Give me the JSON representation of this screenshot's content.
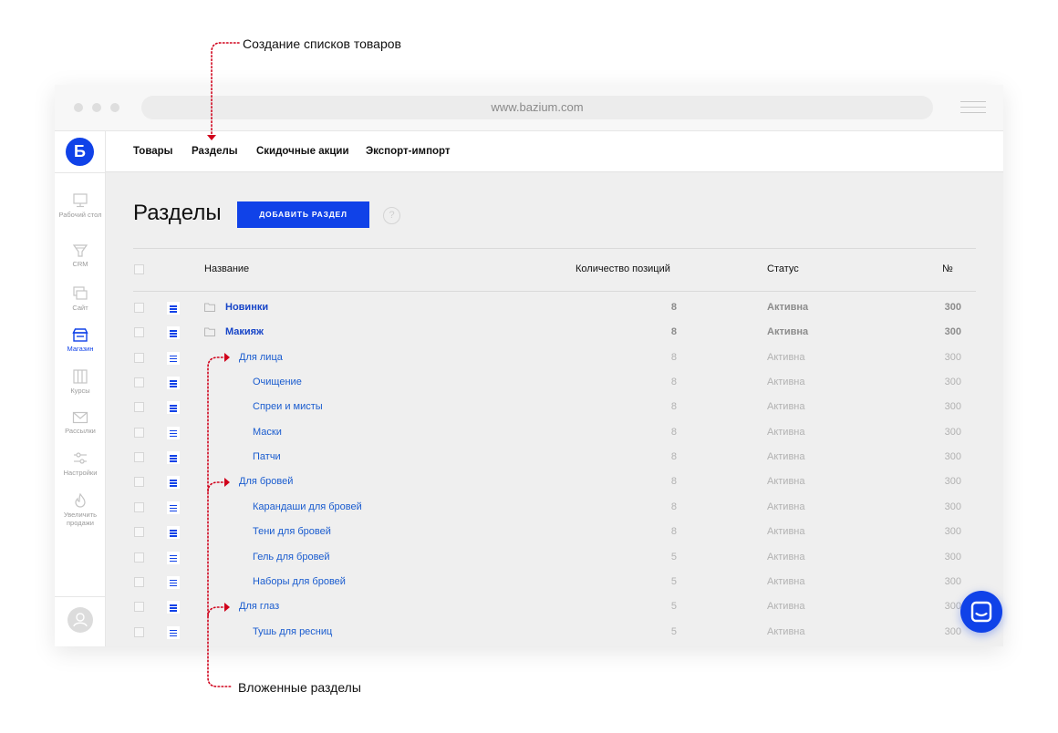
{
  "annotations": {
    "top": "Создание списков товаров",
    "bottom": "Вложенные разделы"
  },
  "browser": {
    "url": "www.bazium.com"
  },
  "logo_letter": "Б",
  "sidebar": {
    "items": [
      {
        "label": "Рабочий стол",
        "icon": "monitor-icon"
      },
      {
        "label": "CRM",
        "icon": "funnel-icon"
      },
      {
        "label": "Сайт",
        "icon": "site-icon"
      },
      {
        "label": "Магазин",
        "icon": "shop-icon",
        "active": true
      },
      {
        "label": "Курсы",
        "icon": "courses-icon"
      },
      {
        "label": "Рассылки",
        "icon": "mail-icon"
      },
      {
        "label": "Настройки",
        "icon": "sliders-icon"
      },
      {
        "label": "Увеличить продажи",
        "icon": "fire-icon"
      }
    ]
  },
  "topnav": {
    "items": [
      "Товары",
      "Разделы",
      "Скидочные акции",
      "Экспорт-импорт"
    ]
  },
  "page": {
    "title": "Разделы",
    "add_button": "ДОБАВИТЬ РАЗДЕЛ",
    "help": "?"
  },
  "table": {
    "headers": {
      "name": "Название",
      "count": "Количество позиций",
      "status": "Статус",
      "number": "№"
    },
    "rows": [
      {
        "name": "Новинки",
        "count": "8",
        "status": "Активна",
        "number": "300",
        "level": 0
      },
      {
        "name": "Макияж",
        "count": "8",
        "status": "Активна",
        "number": "300",
        "level": 0
      },
      {
        "name": "Для лица",
        "count": "8",
        "status": "Активна",
        "number": "300",
        "level": 1
      },
      {
        "name": "Очищение",
        "count": "8",
        "status": "Активна",
        "number": "300",
        "level": 2
      },
      {
        "name": "Спреи и мисты",
        "count": "8",
        "status": "Активна",
        "number": "300",
        "level": 2
      },
      {
        "name": "Маски",
        "count": "8",
        "status": "Активна",
        "number": "300",
        "level": 2
      },
      {
        "name": "Патчи",
        "count": "8",
        "status": "Активна",
        "number": "300",
        "level": 2
      },
      {
        "name": "Для бровей",
        "count": "8",
        "status": "Активна",
        "number": "300",
        "level": 1
      },
      {
        "name": "Карандаши для бровей",
        "count": "8",
        "status": "Активна",
        "number": "300",
        "level": 2
      },
      {
        "name": "Тени для бровей",
        "count": "8",
        "status": "Активна",
        "number": "300",
        "level": 2
      },
      {
        "name": "Гель для бровей",
        "count": "5",
        "status": "Активна",
        "number": "300",
        "level": 2
      },
      {
        "name": "Наборы для бровей",
        "count": "5",
        "status": "Активна",
        "number": "300",
        "level": 2
      },
      {
        "name": "Для глаз",
        "count": "5",
        "status": "Активна",
        "number": "300",
        "level": 1
      },
      {
        "name": "Тушь для ресниц",
        "count": "5",
        "status": "Активна",
        "number": "300",
        "level": 2
      }
    ]
  },
  "colors": {
    "accent": "#1042e8",
    "annotation": "#d0021b",
    "link": "#1a5ccf"
  }
}
